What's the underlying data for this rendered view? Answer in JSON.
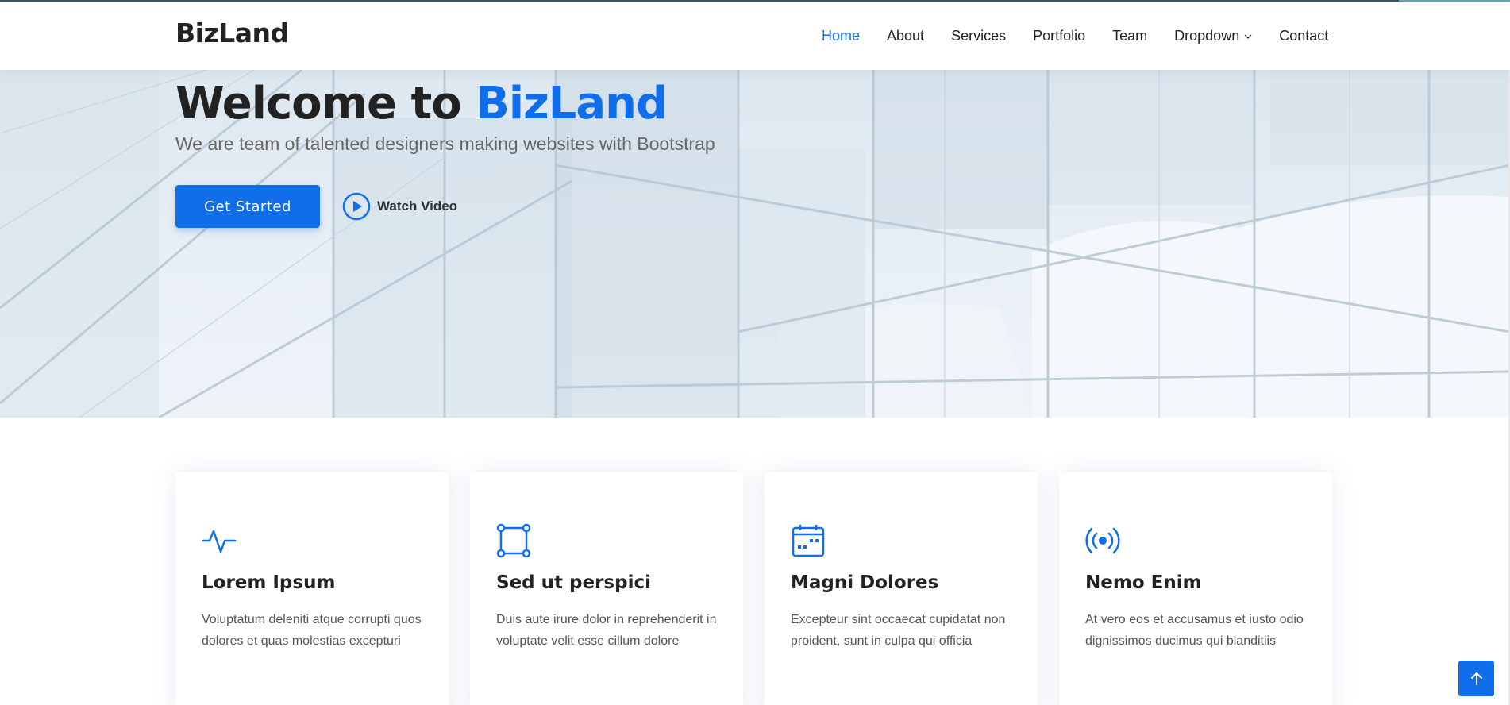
{
  "header": {
    "logo": "BizLand",
    "nav": [
      {
        "label": "Home",
        "active": true
      },
      {
        "label": "About"
      },
      {
        "label": "Services"
      },
      {
        "label": "Portfolio"
      },
      {
        "label": "Team"
      },
      {
        "label": "Dropdown",
        "has_dropdown": true
      },
      {
        "label": "Contact"
      }
    ]
  },
  "hero": {
    "title_prefix": "Welcome to ",
    "title_brand": "BizLand",
    "subtitle": "We are team of talented designers making websites with Bootstrap",
    "cta_label": "Get Started",
    "video_label": "Watch Video"
  },
  "cards": [
    {
      "icon": "activity-icon",
      "title": "Lorem Ipsum",
      "desc": "Voluptatum deleniti atque corrupti quos dolores et quas molestias excepturi"
    },
    {
      "icon": "bounding-box-icon",
      "title": "Sed ut perspici",
      "desc": "Duis aute irure dolor in reprehenderit in voluptate velit esse cillum dolore"
    },
    {
      "icon": "calendar-icon",
      "title": "Magni Dolores",
      "desc": "Excepteur sint occaecat cupidatat non proident, sunt in culpa qui officia"
    },
    {
      "icon": "broadcast-icon",
      "title": "Nemo Enim",
      "desc": "At vero eos et accusamus et iusto odio dignissimos ducimus qui blanditiis"
    }
  ],
  "colors": {
    "accent": "#106eea",
    "heading": "#222222",
    "text": "#555555"
  }
}
